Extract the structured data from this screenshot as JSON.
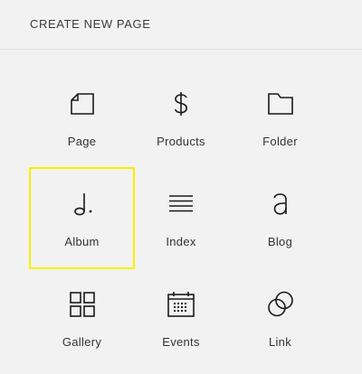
{
  "header": {
    "title": "CREATE NEW PAGE"
  },
  "page_types": [
    {
      "label": "Page",
      "icon": "page-icon",
      "selected": false
    },
    {
      "label": "Products",
      "icon": "dollar-icon",
      "selected": false
    },
    {
      "label": "Folder",
      "icon": "folder-icon",
      "selected": false
    },
    {
      "label": "Album",
      "icon": "music-note-icon",
      "selected": true
    },
    {
      "label": "Index",
      "icon": "index-lines-icon",
      "selected": false
    },
    {
      "label": "Blog",
      "icon": "letter-a-icon",
      "selected": false
    },
    {
      "label": "Gallery",
      "icon": "grid-icon",
      "selected": false
    },
    {
      "label": "Events",
      "icon": "calendar-icon",
      "selected": false
    },
    {
      "label": "Link",
      "icon": "link-circles-icon",
      "selected": false
    }
  ],
  "colors": {
    "background": "#f2f2f2",
    "selection_outline": "#f5f000",
    "icon": "#1a1a1a",
    "text": "#333333"
  }
}
